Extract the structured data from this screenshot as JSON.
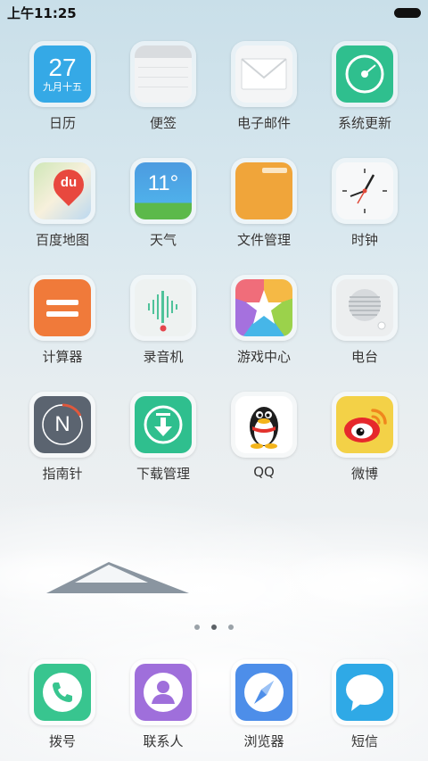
{
  "status_bar": {
    "time": "上午11:25"
  },
  "apps": [
    {
      "label": "日历",
      "day": "27",
      "lunar": "九月十五"
    },
    {
      "label": "便签"
    },
    {
      "label": "电子邮件"
    },
    {
      "label": "系统更新"
    },
    {
      "label": "百度地图",
      "logo_text": "du"
    },
    {
      "label": "天气",
      "temp": "11°"
    },
    {
      "label": "文件管理"
    },
    {
      "label": "时钟"
    },
    {
      "label": "计算器"
    },
    {
      "label": "录音机"
    },
    {
      "label": "游戏中心"
    },
    {
      "label": "电台"
    },
    {
      "label": "指南针",
      "letter": "N"
    },
    {
      "label": "下载管理"
    },
    {
      "label": "QQ"
    },
    {
      "label": "微博"
    }
  ],
  "dock": [
    {
      "label": "拨号"
    },
    {
      "label": "联系人"
    },
    {
      "label": "浏览器"
    },
    {
      "label": "短信"
    }
  ],
  "page_indicator": {
    "count": 3,
    "active": 2
  },
  "colors": {
    "calendar": "#35a9e6",
    "update": "#2fbf8e",
    "weather": "#4c9be0",
    "files": "#f0a53a",
    "calculator": "#f07a3a",
    "download": "#2fbf8e",
    "weibo": "#f3d147",
    "phone": "#38c58f",
    "contacts": "#9f6fdb",
    "browser": "#4d8ee9",
    "sms": "#2fa9e6"
  }
}
